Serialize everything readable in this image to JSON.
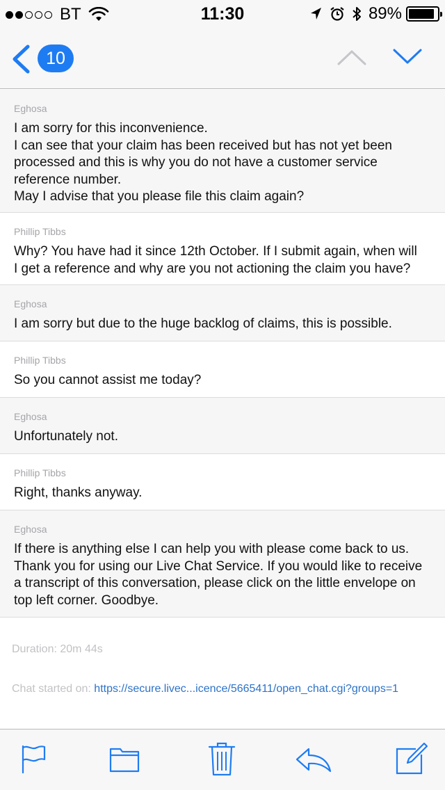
{
  "status_bar": {
    "carrier": "BT",
    "time": "11:30",
    "battery_percent": "89%",
    "battery_level": 0.89,
    "signal_bars_filled": 2,
    "signal_bars_total": 5
  },
  "nav": {
    "unread_count": "10",
    "accent_color": "#1e7cf2"
  },
  "messages": [
    {
      "sender": "Eghosa",
      "lines": [
        "I am sorry for this inconvenience.",
        "I can see that your claim has been received but has not yet been",
        "processed and this is why you do not have a customer service",
        "reference number.",
        "May I advise that you please file this claim again?"
      ]
    },
    {
      "sender": "Phillip Tibbs",
      "lines": [
        "Why? You have had it since 12th October. If I submit again, when will",
        "I get a reference and why are you not actioning the claim you have?"
      ]
    },
    {
      "sender": "Eghosa",
      "lines": [
        "I am sorry but due to the huge backlog of claims, this is possible."
      ]
    },
    {
      "sender": "Phillip Tibbs",
      "lines": [
        "So you cannot assist me today?"
      ]
    },
    {
      "sender": "Eghosa",
      "lines": [
        "Unfortunately not."
      ]
    },
    {
      "sender": "Phillip Tibbs",
      "lines": [
        "Right, thanks anyway."
      ]
    },
    {
      "sender": "Eghosa",
      "lines": [
        "If there is anything else I can help you with please come back to us.",
        "Thank you for using our Live Chat Service. If you would like to receive",
        "a transcript of this conversation, please click on the little envelope on",
        "top left corner. Goodbye."
      ]
    }
  ],
  "footer": {
    "duration": "Duration: 20m 44s",
    "chat_started_label": "Chat started on:",
    "chat_started_link": "https://secure.livec...icence/5665411/open_chat.cgi?groups=1"
  },
  "toolbar": {
    "icons": [
      "flag-icon",
      "folder-icon",
      "trash-icon",
      "reply-icon",
      "compose-icon"
    ]
  }
}
